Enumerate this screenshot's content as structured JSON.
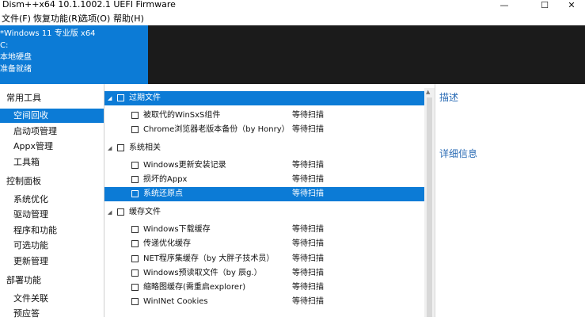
{
  "window": {
    "title": "Dism++x64 10.1.1002.1 UEFI Firmware",
    "minimize_glyph": "—",
    "maximize_glyph": "☐",
    "close_glyph": "✕"
  },
  "menu": {
    "file": "文件(F)",
    "restore": "恢复功能(R)",
    "options": "选项(O)",
    "help": "帮助(H)"
  },
  "system_info": {
    "name": "*Windows 11 专业版 x64",
    "drive": "C:",
    "disk": "本地硬盘",
    "status": "准备就绪"
  },
  "sidebar": {
    "group1": "常用工具",
    "item_space": "空间回收",
    "item_startup": "启动项管理",
    "item_appx": "Appx管理",
    "item_toolbox": "工具箱",
    "group2": "控制面板",
    "item_optimize": "系统优化",
    "item_driver": "驱动管理",
    "item_programs": "程序和功能",
    "item_features": "可选功能",
    "item_updates": "更新管理",
    "group3": "部署功能",
    "item_fileassoc": "文件关联",
    "item_answer": "预应答"
  },
  "cleanup": {
    "group_expired": "过期文件",
    "winsxs": "被取代的WinSxS组件",
    "chrome": "Chrome浏览器老版本备份（by Honry）",
    "group_system": "系统相关",
    "win_update_log": "Windows更新安装记录",
    "broken_appx": "损坏的Appx",
    "restore_point": "系统还原点",
    "group_cache": "缓存文件",
    "win_download_cache": "Windows下载缓存",
    "delivery_cache": "传递优化缓存",
    "net_cache": "NET程序集缓存（by 大胖子技术员）",
    "prefetch": "Windows预读取文件（by 辰g.）",
    "thumb_cache": "缩略图缓存(需重启explorer)",
    "wininet_cookies": "WinINet Cookies",
    "waiting": "等待扫描"
  },
  "right_panel": {
    "description": "描述",
    "details": "详细信息"
  },
  "icons": {
    "expand": "expanded-arrow-icon",
    "checkbox": "checkbox-unchecked"
  },
  "colors": {
    "accent_blue": "#0c7bd6",
    "dark_panel": "#1b1b1b",
    "heading_blue": "#2b6cb5"
  }
}
